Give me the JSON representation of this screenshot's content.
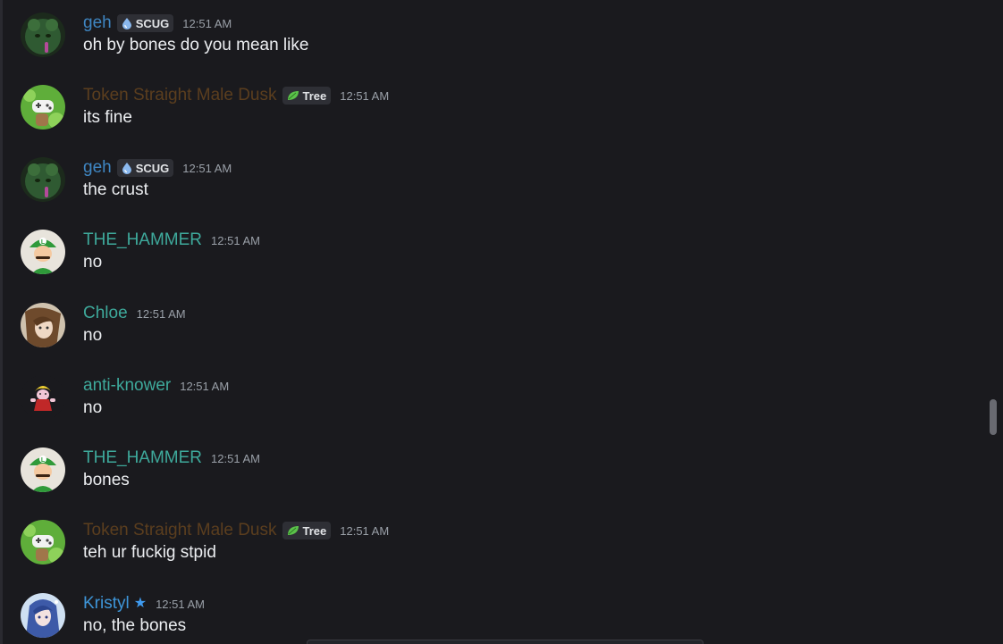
{
  "colors": {
    "geh": "#3f86c2",
    "token": "#5b3e1e",
    "teal": "#3ea99b",
    "kristyl": "#3e96d9",
    "background": "#1a1a1e"
  },
  "messages": [
    {
      "author": "geh",
      "tag": "SCUG",
      "tag_icon": "water-drop-icon",
      "time": "12:51 AM",
      "text": "oh by bones do you mean like"
    },
    {
      "author": "Token Straight Male Dusk",
      "tag": "Tree",
      "tag_icon": "leaf-icon",
      "time": "12:51 AM",
      "text": "its fine"
    },
    {
      "author": "geh",
      "tag": "SCUG",
      "tag_icon": "water-drop-icon",
      "time": "12:51 AM",
      "text": "the crust"
    },
    {
      "author": "THE_HAMMER",
      "time": "12:51 AM",
      "text": "no"
    },
    {
      "author": "Chloe",
      "time": "12:51 AM",
      "text": "no"
    },
    {
      "author": "anti-knower",
      "time": "12:51 AM",
      "text": "no"
    },
    {
      "author": "THE_HAMMER",
      "time": "12:51 AM",
      "text": "bones"
    },
    {
      "author": "Token Straight Male Dusk",
      "tag": "Tree",
      "tag_icon": "leaf-icon",
      "time": "12:51 AM",
      "text": "teh ur fuckig stpid"
    },
    {
      "author": "Kristyl",
      "badge_icon": "star-icon",
      "time": "12:51 AM",
      "text": "no, the bones"
    }
  ]
}
